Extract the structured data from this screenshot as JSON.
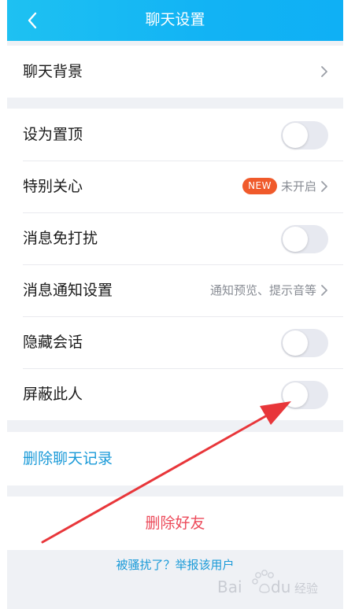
{
  "header": {
    "title": "聊天设置",
    "back_icon": "chevron-left-icon"
  },
  "sections": {
    "background": {
      "label": "聊天背景"
    },
    "pin": {
      "label": "设为置顶",
      "on": false
    },
    "special_care": {
      "label": "特别关心",
      "badge": "NEW",
      "value": "未开启"
    },
    "mute": {
      "label": "消息免打扰",
      "on": false
    },
    "notify": {
      "label": "消息通知设置",
      "value": "通知预览、提示音等"
    },
    "hide": {
      "label": "隐藏会话",
      "on": false
    },
    "block": {
      "label": "屏蔽此人",
      "on": false
    }
  },
  "actions": {
    "clear_history": "删除聊天记录",
    "delete_friend": "删除好友",
    "report": "被骚扰了？举报该用户"
  },
  "watermark": {
    "brand": "Bai",
    "paw": "du",
    "text": "经验"
  },
  "colors": {
    "header": "#12b3f4",
    "link": "#1a9ad8",
    "danger": "#ec4a5a",
    "badge": "#f05a2b",
    "arrow": "#e8363a"
  }
}
